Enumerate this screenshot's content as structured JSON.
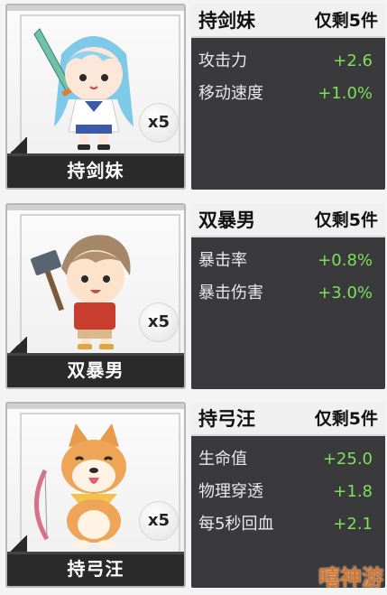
{
  "cards": [
    {
      "plate_name": "持剑妹",
      "quantity": "x5",
      "title": "持剑妹",
      "badge": "仅剩5件",
      "stats": [
        {
          "name": "攻击力",
          "value": "+2.6"
        },
        {
          "name": "移动速度",
          "value": "+1.0%"
        }
      ]
    },
    {
      "plate_name": "双暴男",
      "quantity": "x5",
      "title": "双暴男",
      "badge": "仅剩5件",
      "stats": [
        {
          "name": "暴击率",
          "value": "+0.8%"
        },
        {
          "name": "暴击伤害",
          "value": "+3.0%"
        }
      ]
    },
    {
      "plate_name": "持弓汪",
      "quantity": "x5",
      "title": "持弓汪",
      "badge": "仅剩5件",
      "stats": [
        {
          "name": "生命值",
          "value": "+25.0"
        },
        {
          "name": "物理穿透",
          "value": "+1.8"
        },
        {
          "name": "每5秒回血",
          "value": "+2.1"
        }
      ]
    }
  ],
  "watermark": "嘻神游",
  "colors": {
    "panel_bg": "#3a3a3c",
    "stat_value": "#7be05a",
    "plate_bg": "#2a2a2a"
  }
}
